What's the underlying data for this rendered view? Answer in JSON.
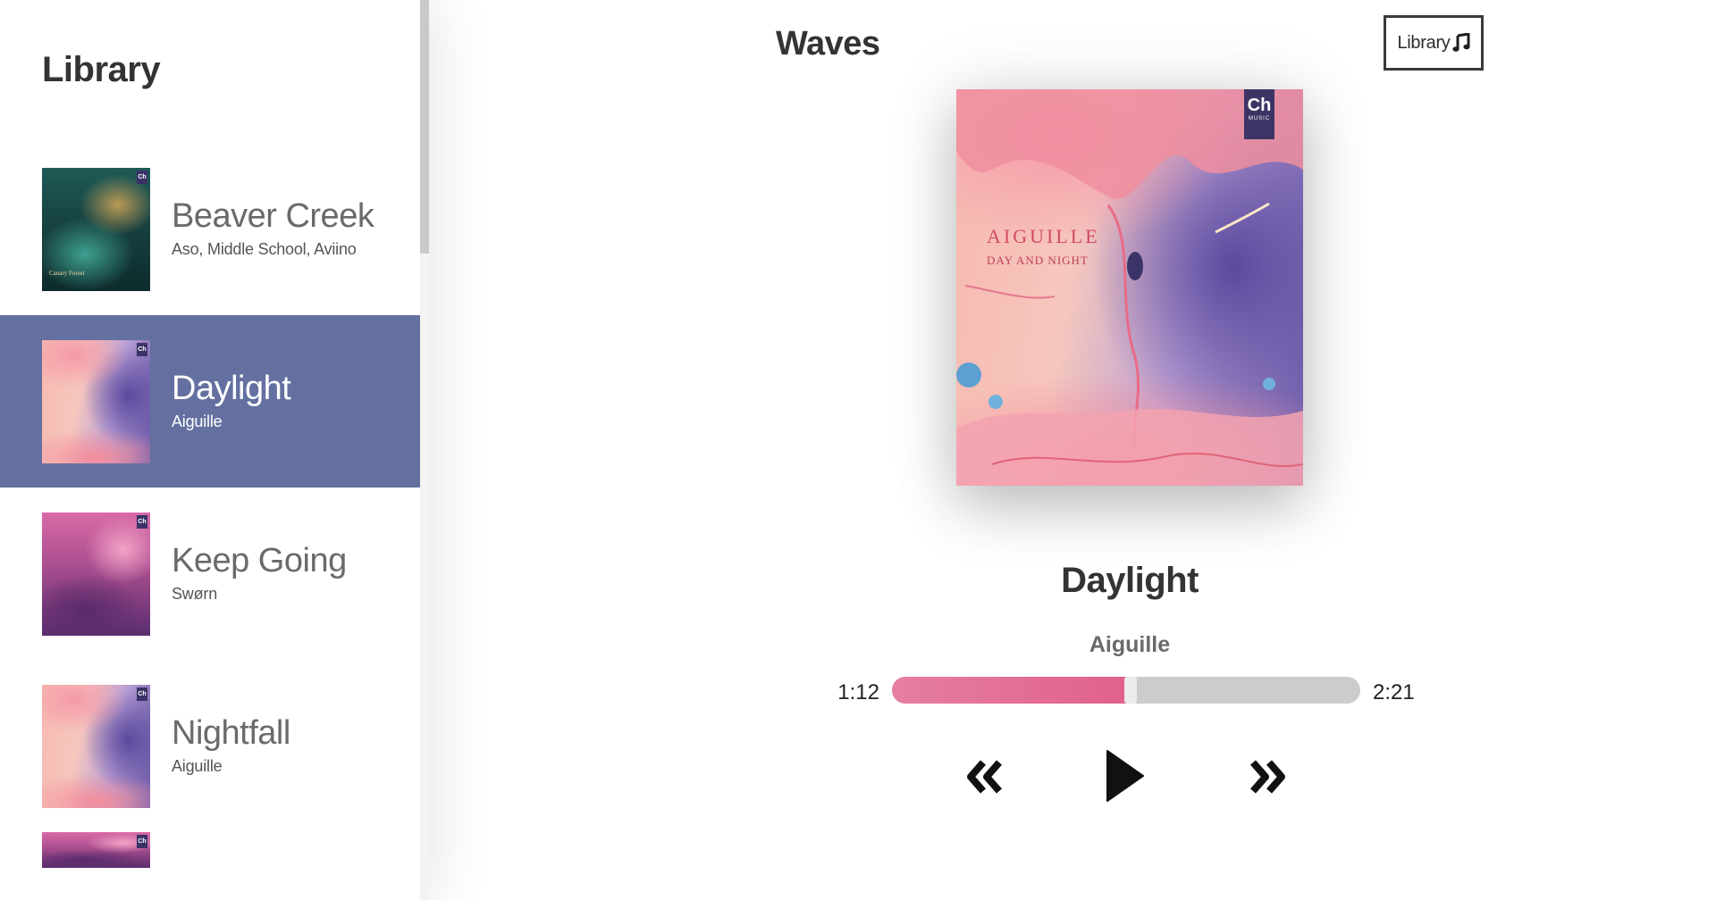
{
  "sidebar": {
    "title": "Library",
    "songs": [
      {
        "name": "Beaver Creek",
        "artist": "Aso, Middle School, Aviino",
        "selected": false,
        "cover_caption": "Canary Forest"
      },
      {
        "name": "Daylight",
        "artist": "Aiguille",
        "selected": true
      },
      {
        "name": "Keep Going",
        "artist": "Swørn",
        "selected": false
      },
      {
        "name": "Nightfall",
        "artist": "Aiguille",
        "selected": false
      },
      {
        "name": "",
        "artist": "",
        "selected": false
      }
    ]
  },
  "header": {
    "app_title": "Waves",
    "library_button_label": "Library"
  },
  "player": {
    "cover_label_artist": "AIGUILLE",
    "cover_label_album": "DAY AND NIGHT",
    "cover_badge": "Ch",
    "cover_badge_sub": "MUSIC",
    "track_title": "Daylight",
    "track_artist": "Aiguille",
    "time_current": "1:12",
    "time_total": "2:21",
    "progress_fraction": 0.51
  },
  "icons": {
    "library_button": "music-note-icon",
    "skip_back": "skip-back-icon",
    "play": "play-icon",
    "skip_forward": "skip-forward-icon"
  },
  "colors": {
    "selected_row": "#6470a0",
    "progress_fill": "#e0608c",
    "progress_track": "#cccccc"
  }
}
